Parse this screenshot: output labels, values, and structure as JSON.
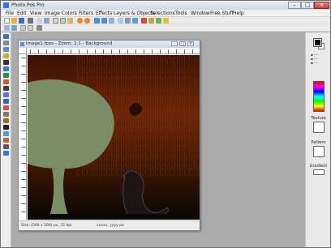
{
  "window": {
    "title": "Photo Pos Pro"
  },
  "menu": [
    "File",
    "Edit",
    "View",
    "Image",
    "Colors",
    "Filters",
    "Effects",
    "Layers & Objects",
    "Selections",
    "Tools",
    "Window",
    "Free Stuff",
    "Help"
  ],
  "document": {
    "title": "Image1.fpos - Zoom: 1:1 - Background",
    "status_size": "Size: (500 x 500) px, 72 dpi",
    "status_coords": "xxxxx, yyyy px"
  },
  "right_panel": {
    "texture_label": "Texture",
    "pattern_label": "Pattern",
    "gradient_label": "Gradient"
  },
  "colors": {
    "foreground": "#000000",
    "background": "#ffffff",
    "workspace": "#ababab"
  }
}
